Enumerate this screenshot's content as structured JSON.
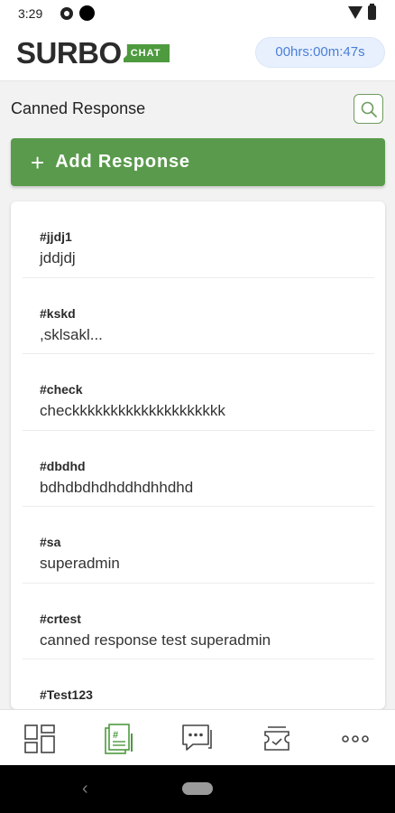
{
  "status_bar": {
    "time": "3:29"
  },
  "header": {
    "logo_text": "SURBO",
    "logo_badge": "CHAT",
    "timer": "00hrs:00m:47s"
  },
  "section": {
    "title": "Canned Response"
  },
  "add_button": {
    "label": "Add Response",
    "icon": "plus-icon"
  },
  "responses": [
    {
      "tag": "#jjdj1",
      "text": "jddjdj"
    },
    {
      "tag": "#kskd",
      "text": ",sklsakl..."
    },
    {
      "tag": "#check",
      "text": "checkkkkkkkkkkkkkkkkkkkk"
    },
    {
      "tag": "#dbdhd",
      "text": "bdhdbdhdhddhdhhdhd"
    },
    {
      "tag": "#sa",
      "text": "superadmin"
    },
    {
      "tag": "#crtest",
      "text": "canned response test superadmin"
    },
    {
      "tag": "#Test123",
      "text": ""
    }
  ],
  "bottom_nav": [
    {
      "icon": "dashboard-icon"
    },
    {
      "icon": "canned-response-icon",
      "active": true
    },
    {
      "icon": "chat-icon"
    },
    {
      "icon": "ticket-icon"
    },
    {
      "icon": "more-icon"
    }
  ],
  "colors": {
    "brand_green": "#5a9a4c",
    "timer_bg": "#e8f0fd",
    "timer_text": "#4a7fd6"
  }
}
